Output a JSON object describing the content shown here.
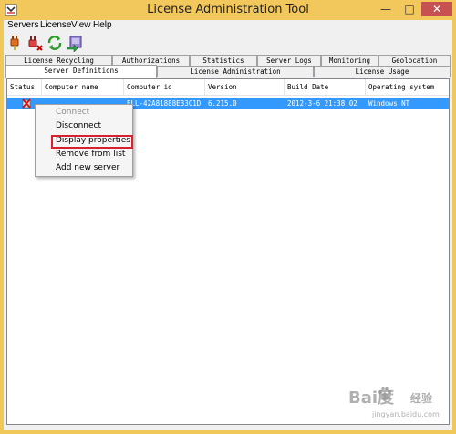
{
  "window": {
    "title": "License Administration Tool",
    "minimize": "—",
    "maximize": "□",
    "close": "✕"
  },
  "menu": [
    {
      "label": "Servers"
    },
    {
      "label": "License"
    },
    {
      "label": "View"
    },
    {
      "label": "Help"
    }
  ],
  "toolbar": [
    {
      "name": "connect-plug-icon"
    },
    {
      "name": "disconnect-plug-icon"
    },
    {
      "name": "refresh-icon"
    },
    {
      "name": "export-icon"
    }
  ],
  "tabs_back": [
    {
      "label": "License Recycling"
    },
    {
      "label": "Authorizations"
    },
    {
      "label": "Statistics"
    },
    {
      "label": "Server Logs"
    },
    {
      "label": "Monitoring"
    },
    {
      "label": "Geolocation"
    }
  ],
  "tabs_front": [
    {
      "label": "Server Definitions",
      "active": true
    },
    {
      "label": "License Administration",
      "active": false
    },
    {
      "label": "License Usage",
      "active": false
    }
  ],
  "table": {
    "columns": [
      "Status",
      "Computer name",
      "Computer id",
      "Version",
      "Build Date",
      "Operating system"
    ],
    "rows": [
      {
        "status_icon": "disconnected-server-icon",
        "computer_name": "",
        "computer_id": "ELL-42A81888E33C1D",
        "version": "6.215.0",
        "build_date": "2012-3-6 21:38:02",
        "os": "Windows NT"
      }
    ]
  },
  "context_menu": [
    {
      "label": "Connect",
      "enabled": false
    },
    {
      "label": "Disconnect",
      "enabled": true
    },
    {
      "label": "Display properties",
      "enabled": true,
      "highlighted": true
    },
    {
      "label": "Remove from list",
      "enabled": true
    },
    {
      "label": "Add new server",
      "enabled": true
    }
  ],
  "watermark": {
    "logo": "Bai度",
    "line1": "经验",
    "line2": "jingyan.baidu.com"
  },
  "colors": {
    "title_bar": "#f2c75c",
    "selection": "#3399ff",
    "highlight_box": "#d9202e",
    "close_button": "#c75050"
  }
}
